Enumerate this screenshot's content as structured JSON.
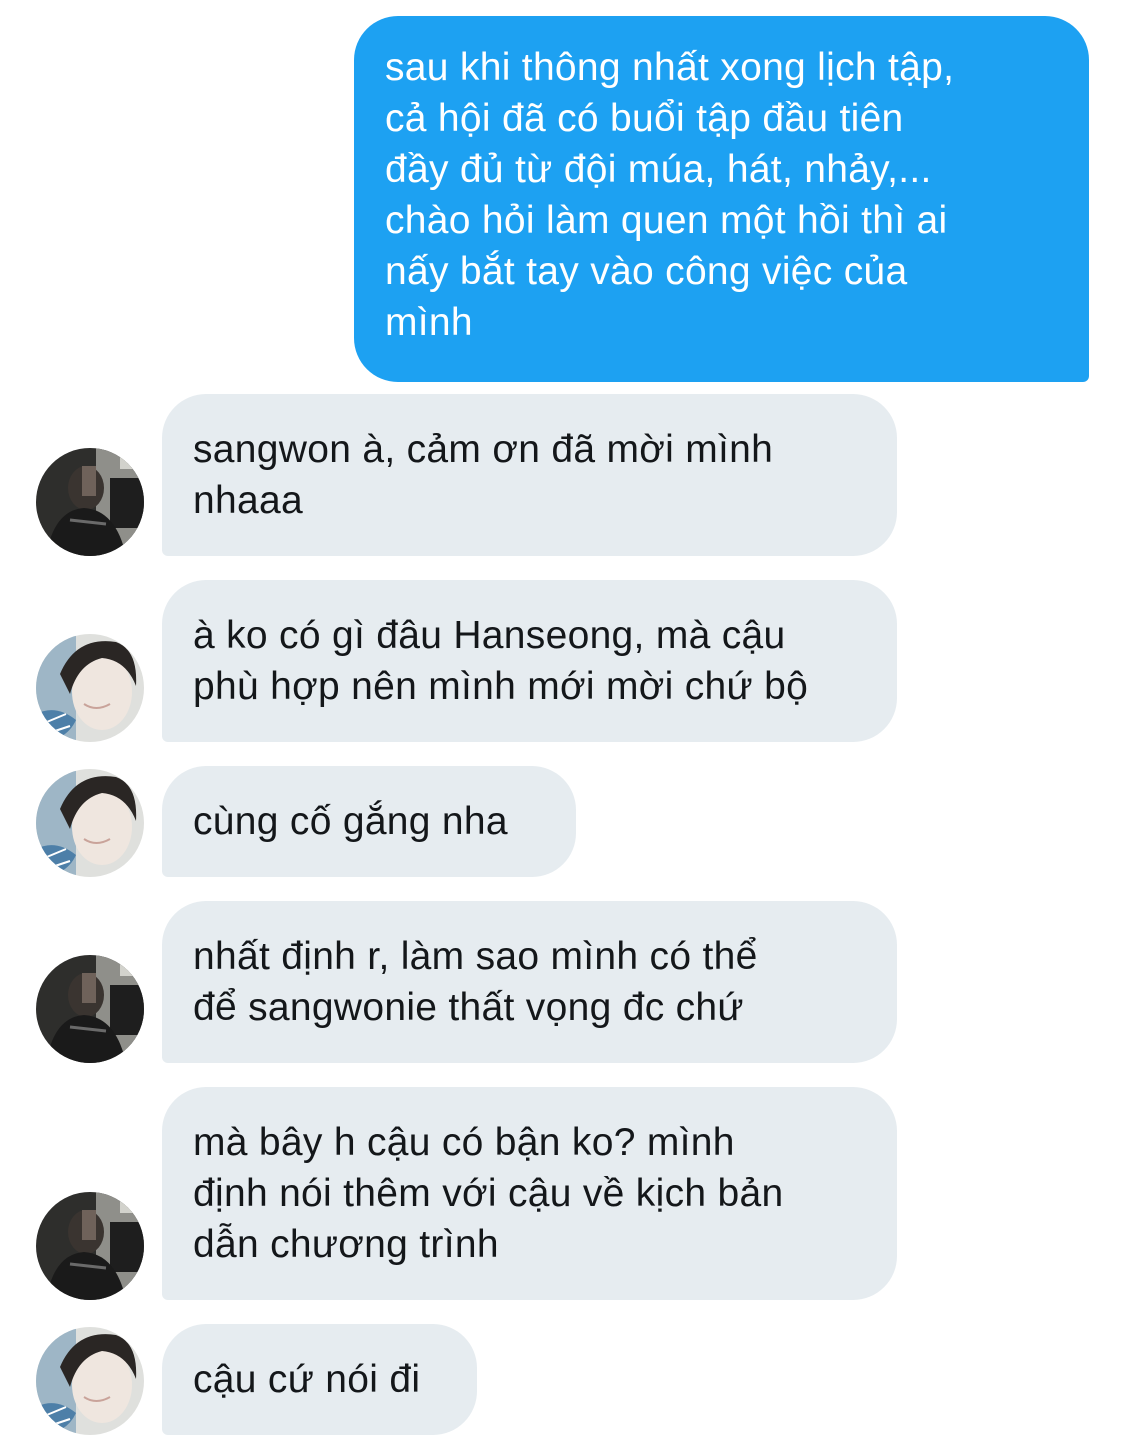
{
  "messages": [
    {
      "direction": "outgoing",
      "text": "sau khi thông nhất xong lịch tập,\ncả hội đã có buổi tập đầu tiên\nđầy đủ từ đội múa, hát, nhảy,...\nchào hỏi làm quen một hồi thì ai\nnấy bắt tay vào công việc của\nmình"
    },
    {
      "direction": "incoming",
      "avatar": "dark-photo-avatar-icon",
      "text": "sangwon à, cảm ơn đã mời mình\nnhaaa"
    },
    {
      "direction": "incoming",
      "avatar": "light-photo-avatar-icon",
      "text": "à ko có gì đâu Hanseong, mà cậu\nphù hợp nên mình mới mời chứ bộ"
    },
    {
      "direction": "incoming",
      "avatar": "light-photo-avatar-icon",
      "text": "cùng cố gắng nha"
    },
    {
      "direction": "incoming",
      "avatar": "dark-photo-avatar-icon",
      "text": "nhất định r, làm sao mình có thể\nđể sangwonie thất vọng đc chứ"
    },
    {
      "direction": "incoming",
      "avatar": "dark-photo-avatar-icon",
      "text": "mà bây h cậu có bận ko? mình\nđịnh nói thêm với cậu về kịch bản\ndẫn chương trình"
    },
    {
      "direction": "incoming",
      "avatar": "light-photo-avatar-icon",
      "text": "cậu cứ nói đi"
    }
  ],
  "colors": {
    "outgoing_bubble": "#1da1f2",
    "incoming_bubble": "#e6ecf0",
    "incoming_text": "#14171a",
    "outgoing_text": "#ffffff"
  }
}
